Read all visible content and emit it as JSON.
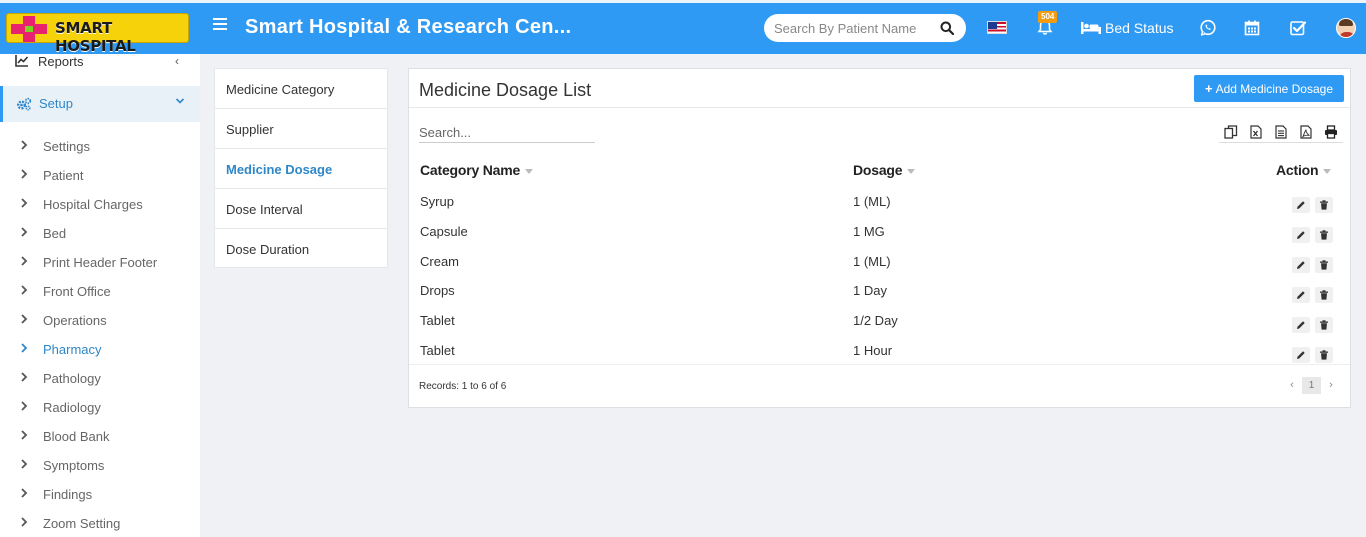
{
  "header": {
    "logo_text": "SMART HOSPITAL",
    "title": "Smart Hospital & Research Cen...",
    "search_placeholder": "Search By Patient Name",
    "notification_count": "504",
    "bed_status_label": "Bed Status",
    "accent_color": "#2f9af3"
  },
  "sidebar": {
    "reports_label": "Reports",
    "setup_label": "Setup",
    "items": [
      {
        "label": "Settings"
      },
      {
        "label": "Patient"
      },
      {
        "label": "Hospital Charges"
      },
      {
        "label": "Bed"
      },
      {
        "label": "Print Header Footer"
      },
      {
        "label": "Front Office"
      },
      {
        "label": "Operations"
      },
      {
        "label": "Pharmacy"
      },
      {
        "label": "Pathology"
      },
      {
        "label": "Radiology"
      },
      {
        "label": "Blood Bank"
      },
      {
        "label": "Symptoms"
      },
      {
        "label": "Findings"
      },
      {
        "label": "Zoom Setting"
      }
    ],
    "active_item": "Pharmacy"
  },
  "submenu": {
    "items": [
      {
        "label": "Medicine Category"
      },
      {
        "label": "Supplier"
      },
      {
        "label": "Medicine Dosage"
      },
      {
        "label": "Dose Interval"
      },
      {
        "label": "Dose Duration"
      }
    ],
    "active_item": "Medicine Dosage"
  },
  "main": {
    "title": "Medicine Dosage List",
    "add_button_label": "Add Medicine Dosage",
    "search_placeholder": "Search...",
    "columns": {
      "category": "Category Name",
      "dosage": "Dosage",
      "action": "Action"
    },
    "rows": [
      {
        "category": "Syrup",
        "dosage": "1 (ML)"
      },
      {
        "category": "Capsule",
        "dosage": "1 MG"
      },
      {
        "category": "Cream",
        "dosage": "1 (ML)"
      },
      {
        "category": "Drops",
        "dosage": "1 Day"
      },
      {
        "category": "Tablet",
        "dosage": "1/2 Day"
      },
      {
        "category": "Tablet",
        "dosage": "1 Hour"
      }
    ],
    "records_text": "Records: 1 to 6 of 6",
    "pagination": {
      "prev": "‹",
      "current_page": "1",
      "next": "›"
    }
  }
}
